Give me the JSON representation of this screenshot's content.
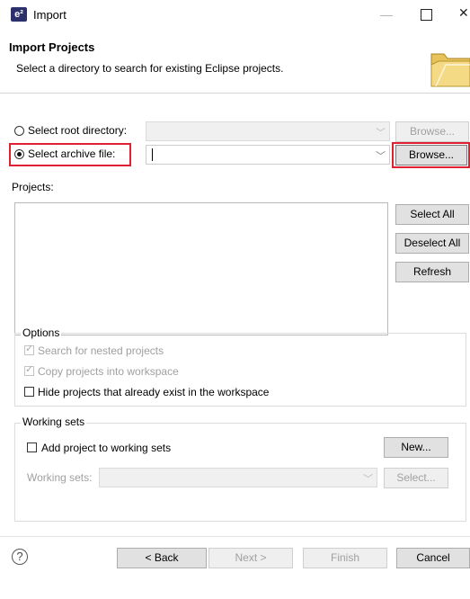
{
  "window": {
    "app_icon_text": "e²",
    "title": "Import"
  },
  "header": {
    "title": "Import Projects",
    "subtitle": "Select a directory to search for existing Eclipse projects."
  },
  "source": {
    "root_dir_label": "Select root directory:",
    "root_dir_selected": false,
    "root_dir_value": "",
    "root_browse_label": "Browse...",
    "archive_label": "Select archive file:",
    "archive_selected": true,
    "archive_value": "",
    "archive_browse_label": "Browse..."
  },
  "projects": {
    "label": "Projects:",
    "items": [],
    "select_all_label": "Select All",
    "deselect_all_label": "Deselect All",
    "refresh_label": "Refresh"
  },
  "options": {
    "title": "Options",
    "search_nested_label": "Search for nested projects",
    "search_nested_checked": true,
    "copy_projects_label": "Copy projects into workspace",
    "copy_projects_checked": true,
    "hide_existing_label": "Hide projects that already exist in the workspace",
    "hide_existing_checked": false
  },
  "working_sets": {
    "title": "Working sets",
    "add_label": "Add project to working sets",
    "add_checked": false,
    "new_label": "New...",
    "sets_label": "Working sets:",
    "sets_value": "",
    "select_label": "Select..."
  },
  "footer": {
    "help_icon": "?",
    "back_label": "< Back",
    "next_label": "Next >",
    "finish_label": "Finish",
    "cancel_label": "Cancel"
  },
  "colors": {
    "highlight": "#e02030",
    "disabled_text": "#a0a0a0"
  }
}
